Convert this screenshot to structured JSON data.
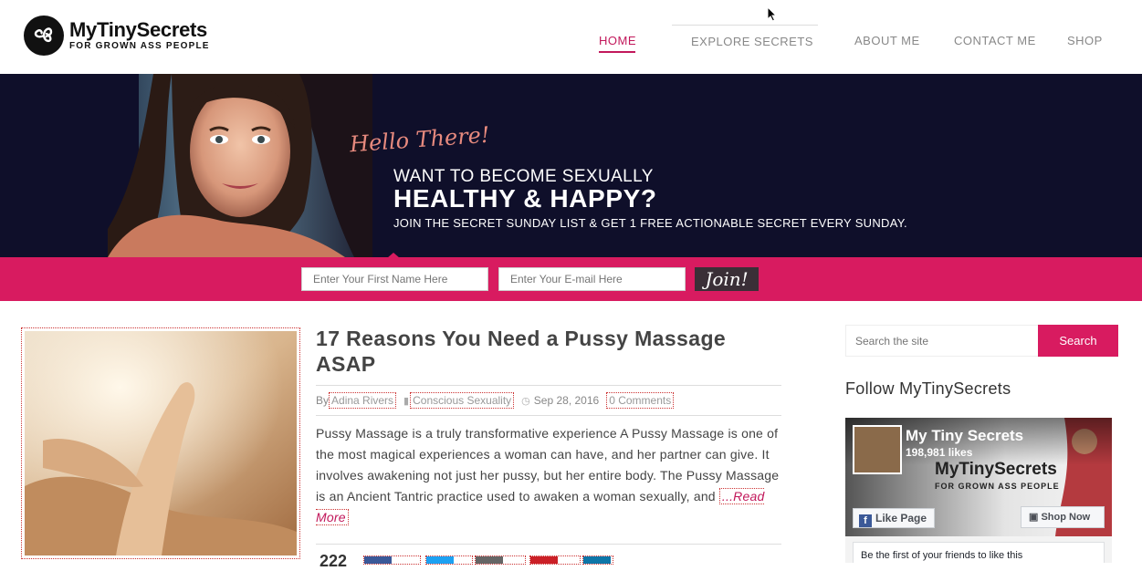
{
  "header": {
    "logo_name": "MyTinySecrets",
    "logo_tagline": "FOR GROWN ASS PEOPLE",
    "nav": [
      {
        "label": "HOME",
        "active": true
      },
      {
        "label": "EXPLORE SECRETS",
        "active": false
      },
      {
        "label": "ABOUT ME",
        "active": false
      },
      {
        "label": "CONTACT ME",
        "active": false
      },
      {
        "label": "SHOP",
        "active": false
      }
    ]
  },
  "hero": {
    "greeting": "Hello There!",
    "line1": "WANT TO BECOME SEXUALLY",
    "line2": "HEALTHY & HAPPY?",
    "line3": "JOIN THE SECRET SUNDAY LIST & GET 1 FREE ACTIONABLE SECRET EVERY SUNDAY."
  },
  "signup": {
    "first_name_placeholder": "Enter Your First Name Here",
    "email_placeholder": "Enter Your E-mail Here",
    "button": "Join!"
  },
  "post": {
    "title": "17 Reasons You Need a Pussy Massage ASAP",
    "by": "By",
    "author": "Adina Rivers",
    "category": "Conscious Sexuality",
    "date": "Sep 28, 2016",
    "comments": "0 Comments",
    "excerpt": "Pussy Massage is a truly transformative experience A Pussy Massage is one of the most magical experiences a woman can have, and her partner can give.  It involves awakening not just her pussy, but her entire body. The Pussy Massage is an Ancient Tantric practice used to awaken a woman sexually, and ",
    "read_more": "...Read More",
    "share_count": "222"
  },
  "sidebar": {
    "search_placeholder": "Search the site",
    "search_button": "Search",
    "follow_title": "Follow MyTinySecrets",
    "fb": {
      "page_name": "My Tiny Secrets",
      "likes": "198,981 likes",
      "brand": "MyTinySecrets",
      "tagline": "FOR GROWN ASS PEOPLE",
      "like_button": "Like Page",
      "shop_button": "Shop Now",
      "friends_text": "Be the first of your friends to like this"
    }
  },
  "colors": {
    "accent": "#d81b60",
    "hero_bg": "#0f0f2a",
    "join_btn": "#3a2f37",
    "facebook": "#3b5998"
  }
}
